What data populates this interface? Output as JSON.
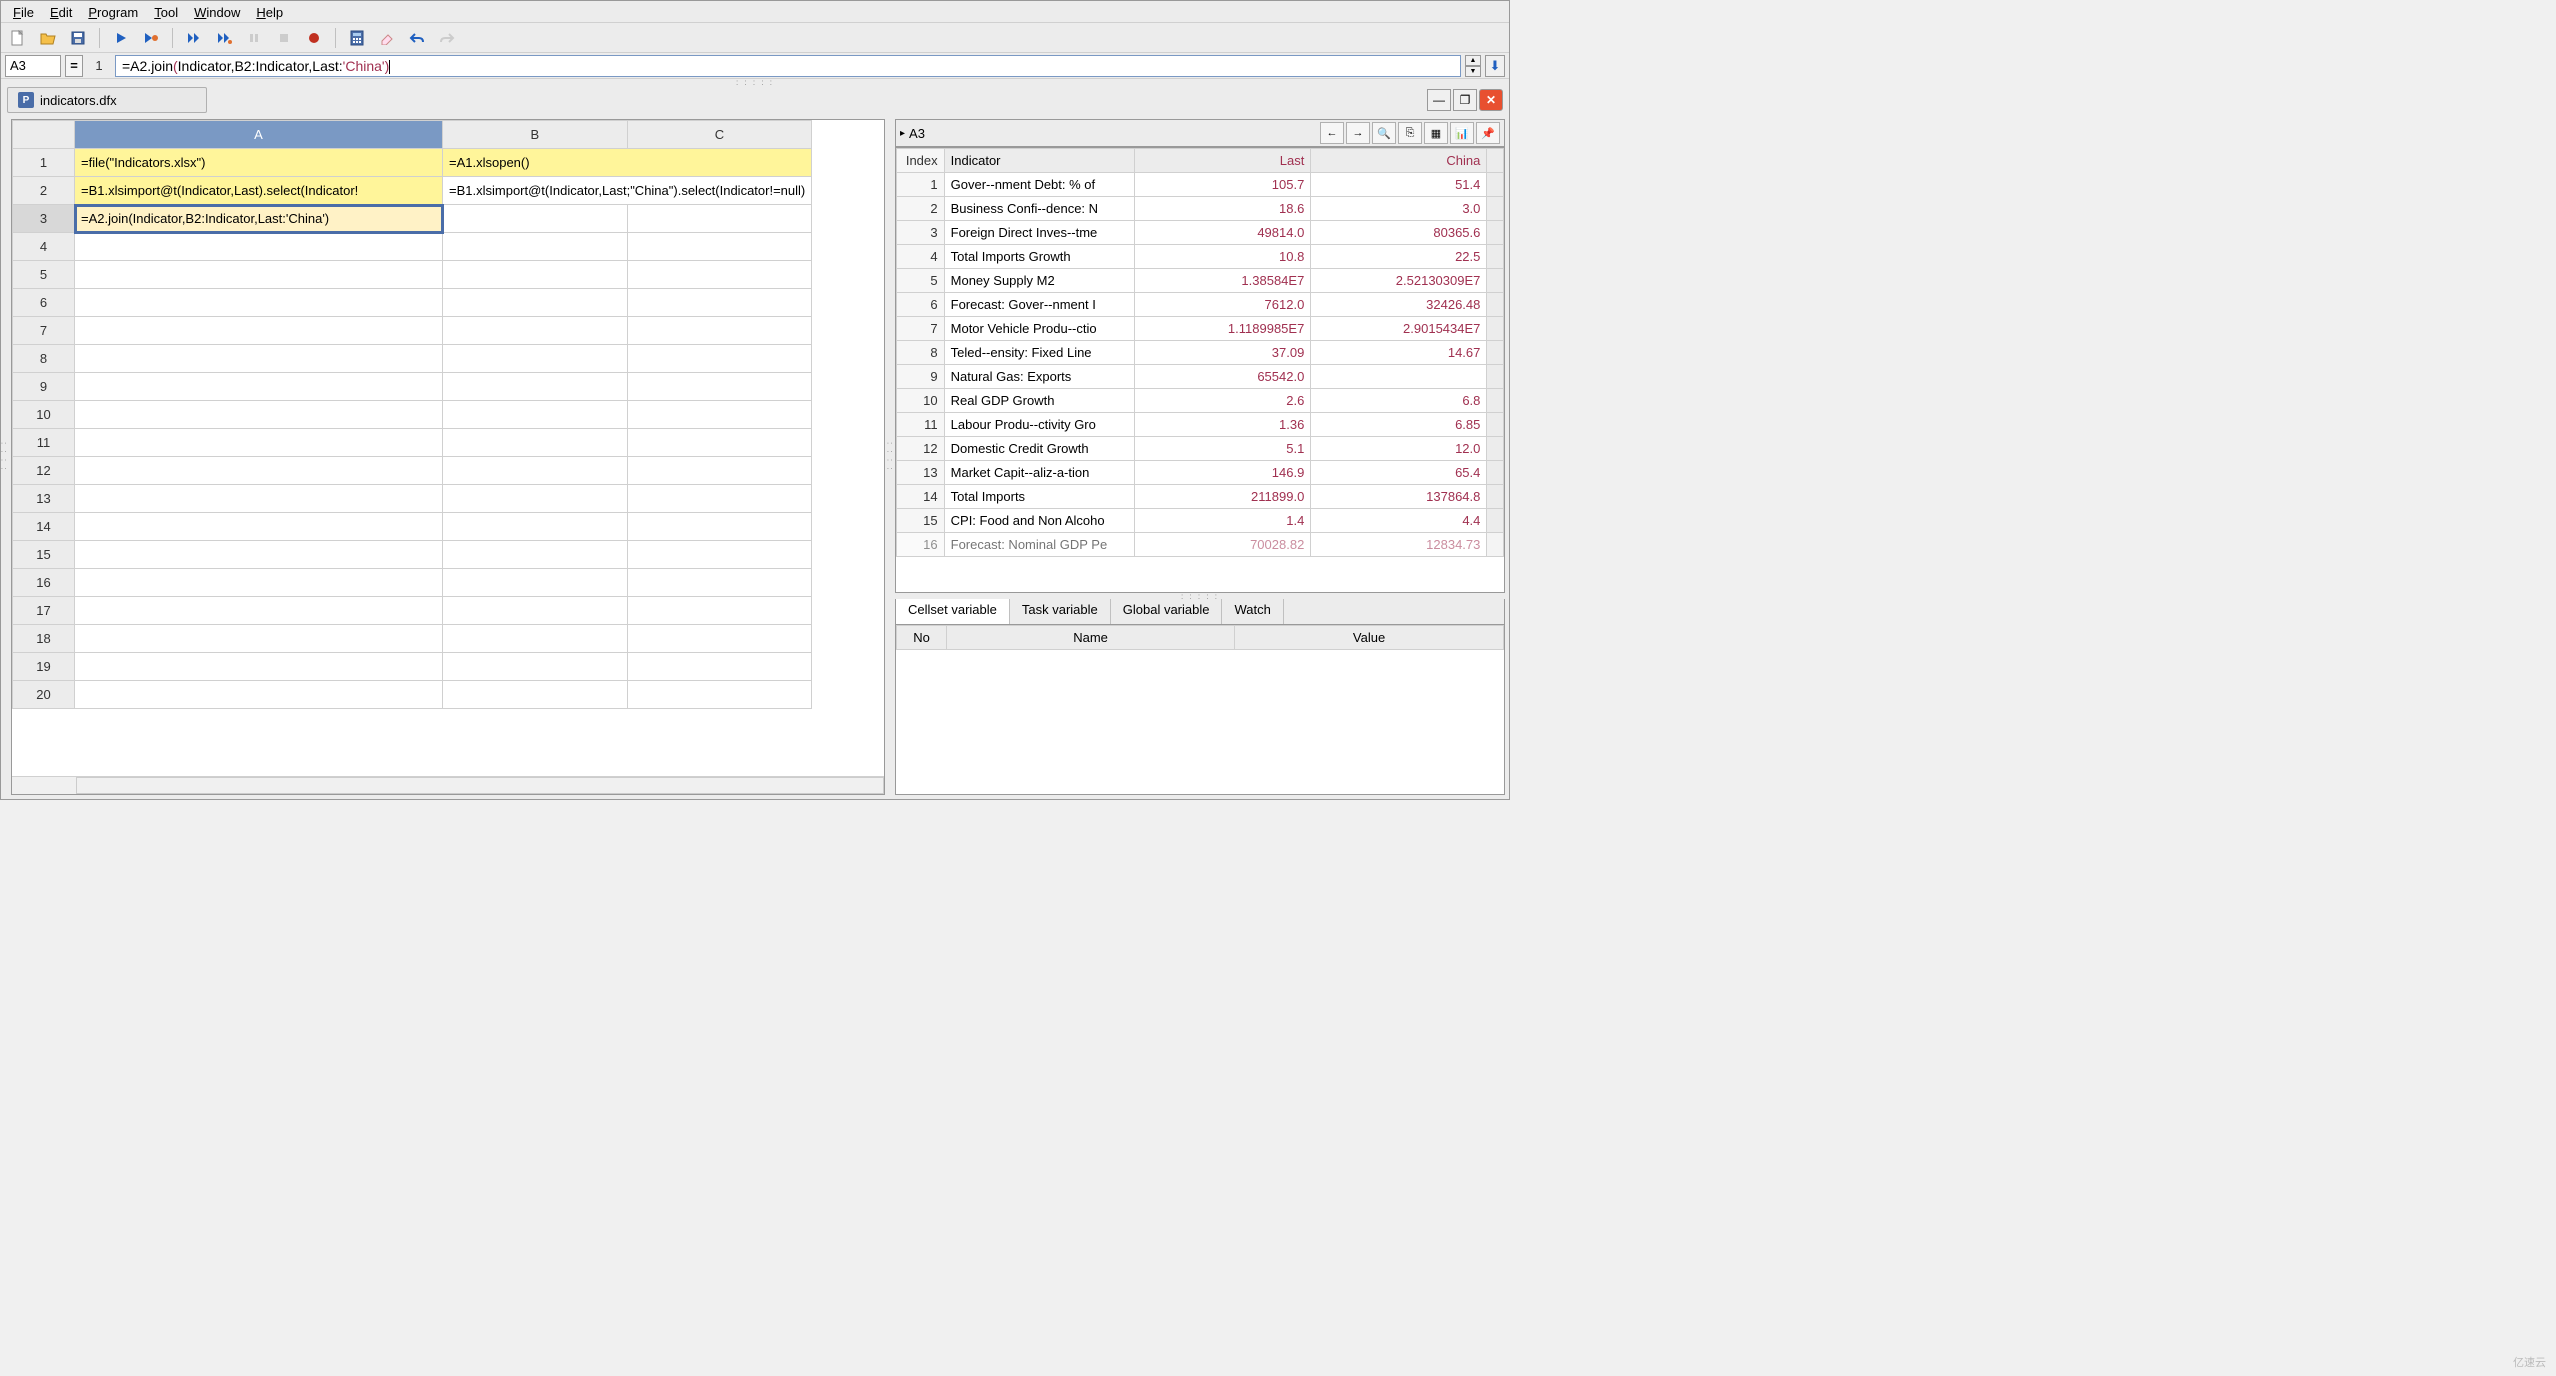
{
  "menu": {
    "file": "File",
    "edit": "Edit",
    "program": "Program",
    "tool": "Tool",
    "window": "Window",
    "help": "Help"
  },
  "cell_ref": "A3",
  "formula_line": "1",
  "formula_prefix": "=A2.join",
  "formula_paren": "(",
  "formula_mid1": "Indicator,B2:Indicator,Last:",
  "formula_str": "'China'",
  "formula_paren2": ")",
  "file_tab": "indicators.dfx",
  "grid": {
    "cols": [
      "A",
      "B",
      "C"
    ],
    "rows": 20,
    "cells": {
      "A1": "=file(\"Indicators.xlsx\")",
      "B1": "=A1.xlsopen()",
      "A2": "=B1.xlsimport@t(Indicator,Last).select(Indicator!",
      "B2": "=B1.xlsimport@t(Indicator,Last;\"China\").select(Indicator!=null)",
      "A3": "=A2.join(Indicator,B2:Indicator,Last:'China')"
    }
  },
  "right_label": "A3",
  "data_headers": {
    "index": "Index",
    "indicator": "Indicator",
    "last": "Last",
    "china": "China"
  },
  "data_rows": [
    {
      "i": 1,
      "ind": "Gover--nment Debt: % of",
      "last": "105.7",
      "china": "51.4"
    },
    {
      "i": 2,
      "ind": "Business Confi--dence: N",
      "last": "18.6",
      "china": "3.0"
    },
    {
      "i": 3,
      "ind": "Foreign Direct Inves--tme",
      "last": "49814.0",
      "china": "80365.6"
    },
    {
      "i": 4,
      "ind": "Total Imports Growth",
      "last": "10.8",
      "china": "22.5"
    },
    {
      "i": 5,
      "ind": "Money Supply M2",
      "last": "1.38584E7",
      "china": "2.52130309E7"
    },
    {
      "i": 6,
      "ind": "Forecast: Gover--nment I",
      "last": "7612.0",
      "china": "32426.48"
    },
    {
      "i": 7,
      "ind": "Motor Vehicle Produ--ctio",
      "last": "1.1189985E7",
      "china": "2.9015434E7"
    },
    {
      "i": 8,
      "ind": "Teled--ensity: Fixed Line",
      "last": "37.09",
      "china": "14.67"
    },
    {
      "i": 9,
      "ind": "Natural Gas: Exports",
      "last": "65542.0",
      "china": ""
    },
    {
      "i": 10,
      "ind": "Real GDP Growth",
      "last": "2.6",
      "china": "6.8"
    },
    {
      "i": 11,
      "ind": "Labour Produ--ctivity Gro",
      "last": "1.36",
      "china": "6.85"
    },
    {
      "i": 12,
      "ind": "Domestic Credit Growth",
      "last": "5.1",
      "china": "12.0"
    },
    {
      "i": 13,
      "ind": "Market Capit--aliz-a-tion",
      "last": "146.9",
      "china": "65.4"
    },
    {
      "i": 14,
      "ind": "Total Imports",
      "last": "211899.0",
      "china": "137864.8"
    },
    {
      "i": 15,
      "ind": "CPI: Food and Non Alcoho",
      "last": "1.4",
      "china": "4.4"
    },
    {
      "i": 16,
      "ind": "Forecast: Nominal GDP Pe",
      "last": "70028.82",
      "china": "12834.73"
    }
  ],
  "var_tabs": {
    "cellset": "Cellset variable",
    "task": "Task variable",
    "global": "Global variable",
    "watch": "Watch"
  },
  "var_headers": {
    "no": "No",
    "name": "Name",
    "value": "Value"
  },
  "watermark": "亿速云"
}
